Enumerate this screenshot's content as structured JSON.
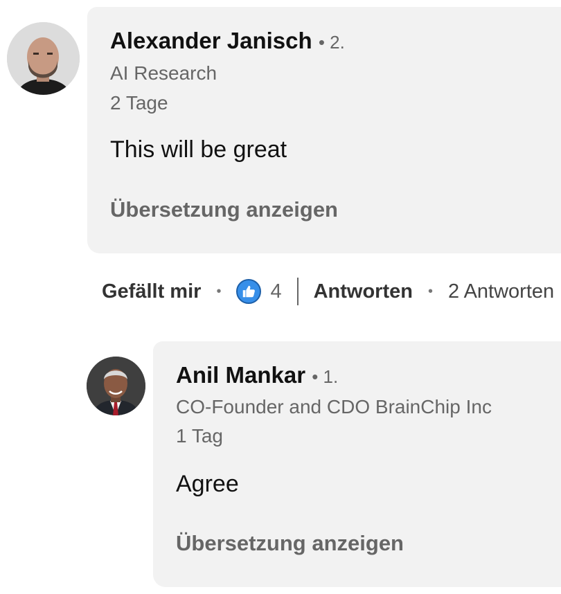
{
  "comments": [
    {
      "author": "Alexander Janisch",
      "degree": "• 2.",
      "headline": "AI Research",
      "time": "2 Tage",
      "text": "This will be great",
      "translate_label": "Übersetzung anzeigen"
    },
    {
      "author": "Anil Mankar",
      "degree": "• 1.",
      "headline": "CO-Founder and CDO BrainChip Inc",
      "time": "1 Tag",
      "text": "Agree",
      "translate_label": "Übersetzung anzeigen"
    }
  ],
  "actions": {
    "like_label": "Gefällt mir",
    "separator_dot": "•",
    "reaction_count": "4",
    "reply_label": "Antworten",
    "replies_count": "2 Antworten"
  },
  "colors": {
    "bubble_bg": "#f2f2f2",
    "like_blue": "#378fe9",
    "secondary_text": "#666666"
  }
}
